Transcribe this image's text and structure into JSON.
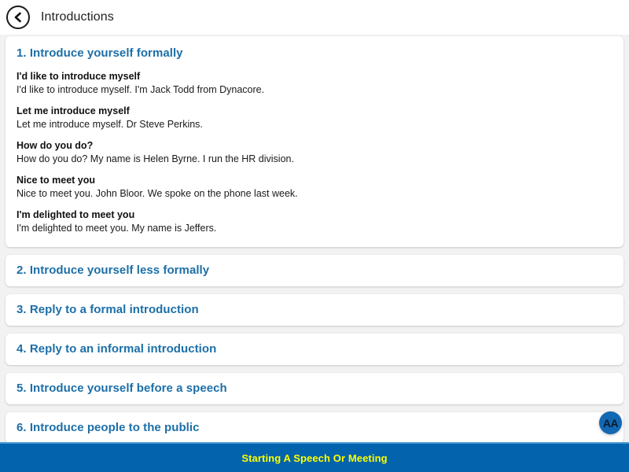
{
  "header": {
    "back_icon": "chevron-left-icon",
    "title": "Introductions"
  },
  "sections": [
    {
      "title": "1. Introduce yourself formally",
      "expanded": true,
      "phrases": [
        {
          "head": "I'd like to introduce myself",
          "example": "I'd like to introduce myself. I'm Jack Todd from Dynacore."
        },
        {
          "head": "Let me introduce myself",
          "example": "Let me introduce myself. Dr Steve Perkins."
        },
        {
          "head": "How do you do?",
          "example": "How do you do? My name is Helen Byrne. I run the HR division."
        },
        {
          "head": "Nice to meet you",
          "example": "Nice to meet you. John Bloor. We spoke on the phone last week."
        },
        {
          "head": "I'm delighted to meet you",
          "example": "I'm delighted to meet you. My name is Jeffers."
        }
      ]
    },
    {
      "title": "2. Introduce yourself less formally",
      "expanded": false,
      "phrases": []
    },
    {
      "title": "3. Reply to a formal introduction",
      "expanded": false,
      "phrases": []
    },
    {
      "title": "4. Reply to an informal introduction",
      "expanded": false,
      "phrases": []
    },
    {
      "title": "5. Introduce yourself before a speech",
      "expanded": false,
      "phrases": []
    },
    {
      "title": "6. Introduce people to the public",
      "expanded": false,
      "phrases": []
    }
  ],
  "font_size_button": {
    "label": "AA",
    "icon": "text-size-icon"
  },
  "bottom_bar": {
    "label": "Starting A Speech Or Meeting"
  },
  "colors": {
    "accent_blue": "#1c6fa8",
    "bar_blue": "#0364ad",
    "bar_text_yellow": "#ffff00",
    "fab_blue": "#1268b3",
    "page_background": "#f2f2f3"
  }
}
